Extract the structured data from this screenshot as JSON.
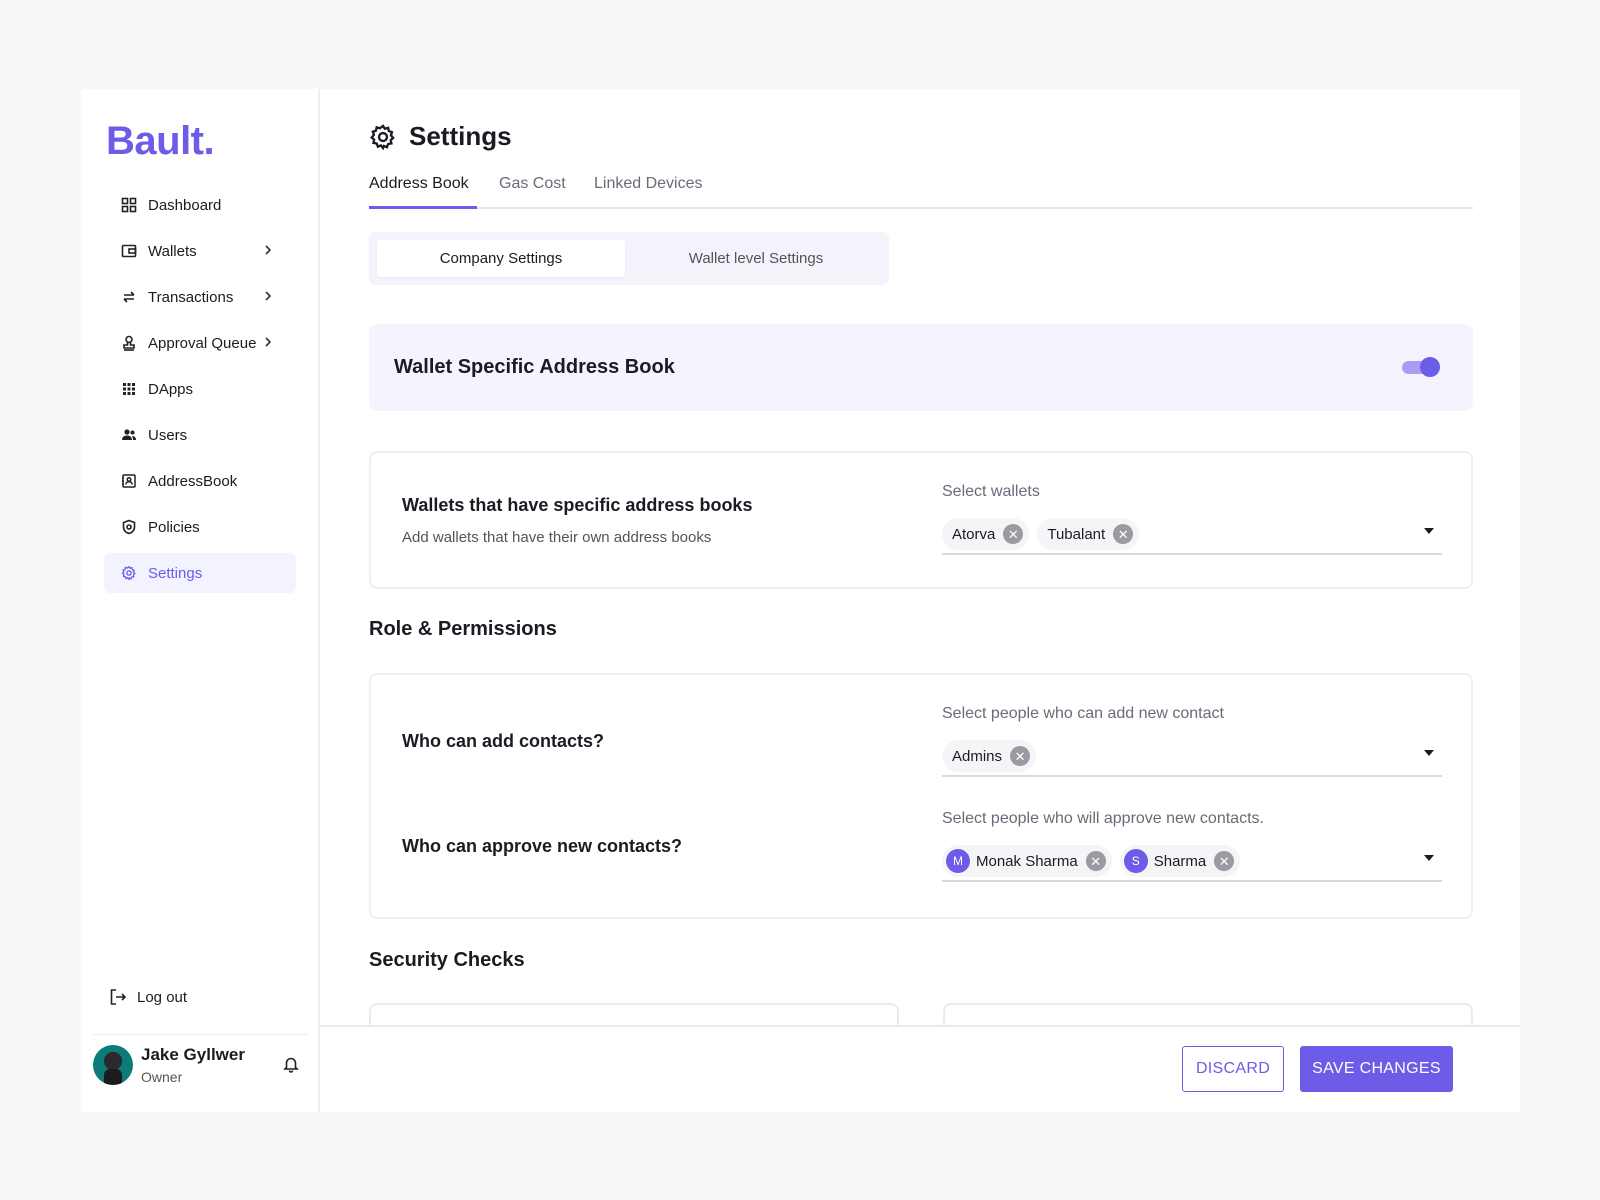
{
  "brand": {
    "logo": "Bault.",
    "accent": "#6c5ce7"
  },
  "sidebar": {
    "items": [
      {
        "label": "Dashboard",
        "icon": "grid-icon"
      },
      {
        "label": "Wallets",
        "icon": "wallet-icon",
        "has_submenu": true
      },
      {
        "label": "Transactions",
        "icon": "arrows-icon",
        "has_submenu": true
      },
      {
        "label": "Approval Queue",
        "icon": "stamp-icon",
        "has_submenu": true
      },
      {
        "label": "DApps",
        "icon": "apps-icon"
      },
      {
        "label": "Users",
        "icon": "users-icon"
      },
      {
        "label": "AddressBook",
        "icon": "addressbook-icon"
      },
      {
        "label": "Policies",
        "icon": "shield-icon"
      },
      {
        "label": "Settings",
        "icon": "gear-icon",
        "active": true
      }
    ],
    "logout_label": "Log out",
    "user": {
      "name": "Jake Gyllwer",
      "role": "Owner"
    }
  },
  "page": {
    "title": "Settings",
    "tabs": [
      "Address Book",
      "Gas Cost",
      "Linked Devices"
    ],
    "active_tab": "Address Book",
    "segments": [
      "Company Settings",
      "Wallet level Settings"
    ],
    "active_segment": "Company Settings"
  },
  "banner": {
    "title": "Wallet Specific Address Book",
    "toggle_on": true
  },
  "wallets_card": {
    "title": "Wallets that have specific address books",
    "subtitle": "Add wallets that have their own address books",
    "select_label": "Select wallets",
    "chips": [
      "Atorva",
      "Tubalant"
    ]
  },
  "roles": {
    "section_title": "Role & Permissions",
    "add": {
      "question": "Who can add contacts?",
      "select_label": "Select people who can add new contact",
      "chips": [
        "Admins"
      ]
    },
    "approve": {
      "question": "Who can approve new contacts?",
      "select_label": "Select people who will approve new contacts.",
      "chips": [
        {
          "initial": "M",
          "name": "Monak Sharma"
        },
        {
          "initial": "S",
          "name": "Sharma"
        }
      ]
    }
  },
  "security": {
    "section_title": "Security Checks"
  },
  "footer": {
    "discard_label": "DISCARD",
    "save_label": "SAVE CHANGES"
  }
}
